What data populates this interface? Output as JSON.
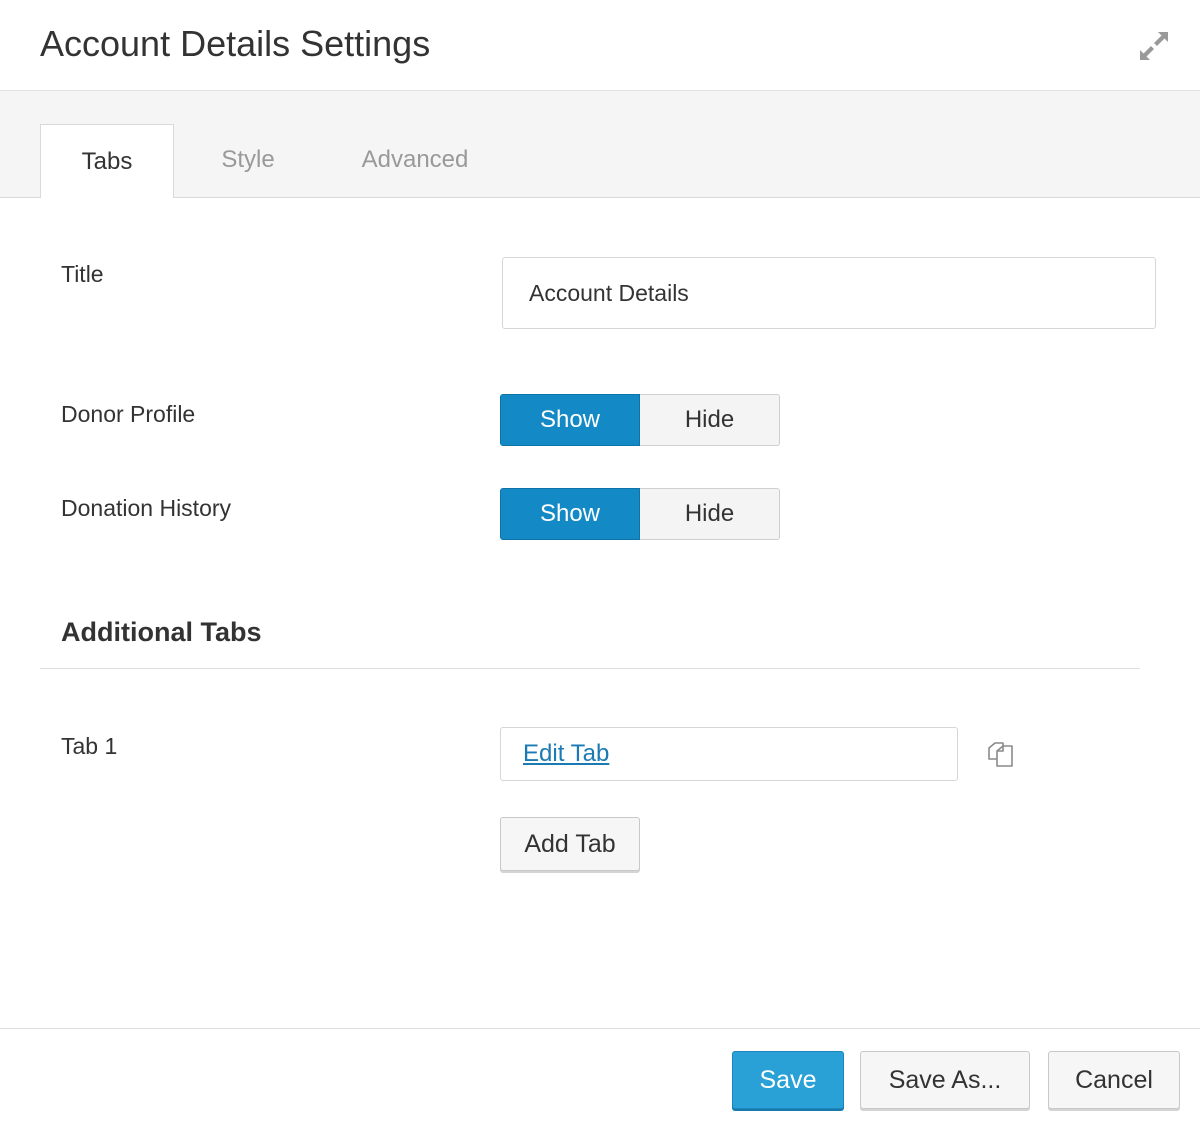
{
  "header": {
    "title": "Account Details Settings",
    "expand_icon": "expand-arrows-icon"
  },
  "tabs": [
    {
      "label": "Tabs",
      "active": true
    },
    {
      "label": "Style",
      "active": false
    },
    {
      "label": "Advanced",
      "active": false
    }
  ],
  "form": {
    "title": {
      "label": "Title",
      "value": "Account Details"
    },
    "donor_profile": {
      "label": "Donor Profile",
      "show": "Show",
      "hide": "Hide",
      "selected": "Show"
    },
    "donation_history": {
      "label": "Donation History",
      "show": "Show",
      "hide": "Hide",
      "selected": "Show"
    }
  },
  "additional_tabs": {
    "heading": "Additional Tabs",
    "items": [
      {
        "label": "Tab 1",
        "link": "Edit Tab",
        "action_icon": "copy-icon"
      }
    ],
    "add_label": "Add Tab"
  },
  "footer": {
    "save": "Save",
    "save_as": "Save As...",
    "cancel": "Cancel"
  },
  "colors": {
    "accent": "#1389c6",
    "primary_button": "#2aa1d6",
    "link": "#1a7ab4",
    "tab_bar": "#f5f5f5"
  }
}
